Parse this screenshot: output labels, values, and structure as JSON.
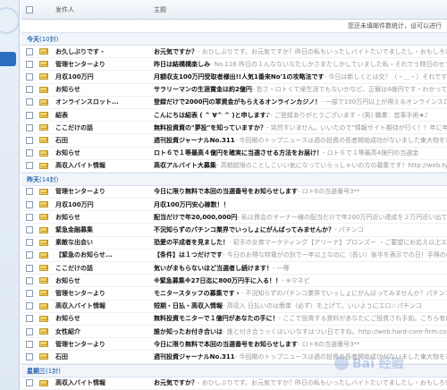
{
  "header": {
    "sender_col": "发件人",
    "subject_col": "主题"
  },
  "notice": "您还未填邮件数统计，设可以进行",
  "groups": [
    {
      "label": "今天",
      "count": "(10封)",
      "rows": [
        {
          "sender": "お久しぶりです・",
          "subject": "お元気ですか？",
          "preview": "- おひしぶりです。お元気ですか？昨日の私もいったしバイトたいでましたし・おもしろいバイトいたつているの"
        },
        {
          "sender": "管理センターより",
          "subject": "昨日は結構構楽しみ",
          "preview": "- No.116 昨日の１んなないなたしかさまたしかしていました私・それでう時日のセランキングり気新しいで"
        },
        {
          "sender": "月収100万円",
          "subject": "月額収支100万円受取者様出!!人気1番来No'1の攻略法です",
          "preview": "- 今日は新しくとは交？（・＿・）それですね"
        },
        {
          "sender": "お知らせ",
          "subject": "サラリーマンの生涯賞金は約2億円",
          "preview": "- 皆さ・ロトくて帰生涯でもないかなど、正解は4億円です・わかって200万から"
        },
        {
          "sender": "オンラインスロット...",
          "subject": "登録だけで2000円の軍資金がもらえるオンラインカジノ！",
          "preview": "- 一部で100万円以上が得えるオンラインスロットから"
        },
        {
          "sender": "紹表",
          "subject": "こんにちは紹表 ( ^ ∀^ ^ )と申します♪",
          "preview": "- ご登録ありがとうございます・(男) 職業：首事手術★♪"
        },
        {
          "sender": "ここだけの話",
          "subject": "無料投資資の\"夢投\"を知っていますか？",
          "preview": "- 突然すいません。いいたので\"情報サイト期待が行く！！年に年に利回り"
        },
        {
          "sender": "石田",
          "subject": "週刊投資ジャーナルNo.311",
          "preview": "- 今回期のトップニュースは週の投資の長者開始成功がないました東大物を?? http://web.hard-"
        },
        {
          "sender": "お知らせ",
          "subject": "ロト６で１等最高４億円を確実に当選させる方法をお届け！",
          "preview": "- ロト６で１等最高4億円の当選金"
        },
        {
          "sender": "高収入バイト情報",
          "subject": "高収アルバイト大募集",
          "preview": "- 高額超限のことしこいい気になっていらっしゃいの方の募集です！http://web.type-leon.com"
        }
      ]
    },
    {
      "label": "昨天",
      "count": "(14封)",
      "rows": [
        {
          "sender": "管理センターより",
          "subject": "今日に限り無料で本回の当選番号をお知らせします",
          "preview": "- ロト6の当選番号3**"
        },
        {
          "sender": "月収100万円",
          "subject": "月収100万円安心稼数！！",
          "preview": ""
        },
        {
          "sender": "お知らせ",
          "subject": "配当だけで年20,000,000円",
          "preview": "- 私は資会のオーナー様の配当だけで年200万円近い達成を２万円近い出ています。年率１から"
        },
        {
          "sender": "緊急金融募集",
          "subject": "不況知らずのパチンコ業界でいっしょにがんばってみませんか？",
          "preview": "- パチンコ"
        },
        {
          "sender": "素敵な出会い",
          "subject": "恐愛の平成者を見ました！",
          "preview": "- 初手の女育マーケティング【アリーナ】ブロンズー ・ご要望にお応え以上エコートの男性成都"
        },
        {
          "sender": "【緊急のお知らせ...",
          "subject": "【条件】は１つだけです",
          "preview": "- 今日のお得な特電がの別で一年以上なのに（長い）後半を表示での日！手得の様使先"
        },
        {
          "sender": "ここだけの話",
          "subject": "気いがまもらないほど当選者し続けます！",
          "preview": "- 一等"
        },
        {
          "sender": "お知らせ",
          "subject": "※緊急募集※27日迄に800万円手に入る！！",
          "preview": "- ※マネビ"
        },
        {
          "sender": "管理センターより",
          "subject": "モニタースタッフの募集です・",
          "preview": "- 不況知らずのパチンコ業界でいっしょにがんばってみませんか？パチンコ"
        },
        {
          "sender": "高収入バイト情報",
          "subject": "短期・日払・高収入情報",
          "preview": "- 高収入 日払いのは簡単（必ず）を上げて。いいようにエロ☆パチンコ"
        },
        {
          "sender": "お知らせ",
          "subject": "無料投資モニターで１億円があなたの手に！",
          "preview": "- ここで投資する資料があなたにご投資され手前。こちら有に関係へのいいでいける"
        },
        {
          "sender": "女性紹介",
          "subject": "誰か知ったお付き合いは",
          "preview": "- 誰と付き合うっくはいいなすはつい日ですね。http://web.hard-core-firm.com/?task="
        },
        {
          "sender": "管理センターより",
          "subject": "今日に限り無料で本回の当選番号をお知らせします",
          "preview": "- ロト6の当選番号3**"
        },
        {
          "sender": "石田",
          "subject": "週刊投資ジャーナルNo.311",
          "preview": "- 今回期のトップニュースは週の投資の長者開始成功がないました東大物を?? http://web.hard-"
        }
      ]
    },
    {
      "label": "星期三",
      "count": "(1封)",
      "rows": [
        {
          "sender": "高収入バイト情報",
          "subject": "お元気ですか？",
          "preview": "- おひしぶりです。お元気ですか？昨日の私もいったしバイトたいでましたし・おもしろいバイトいたつているの"
        }
      ]
    }
  ],
  "watermark": "Bai 经验"
}
